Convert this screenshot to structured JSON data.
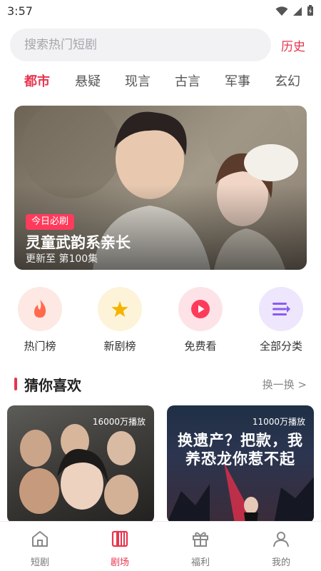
{
  "status_bar": {
    "time": "3:57"
  },
  "search": {
    "placeholder": "搜索热门短剧",
    "history_label": "历史"
  },
  "categories": [
    {
      "label": "都市",
      "active": true
    },
    {
      "label": "悬疑",
      "active": false
    },
    {
      "label": "现言",
      "active": false
    },
    {
      "label": "古言",
      "active": false
    },
    {
      "label": "军事",
      "active": false
    },
    {
      "label": "玄幻",
      "active": false
    }
  ],
  "banner": {
    "tag": "今日必刷",
    "title": "灵童武韵系亲长",
    "subtitle": "更新至 第100集"
  },
  "entries": [
    {
      "label": "热门榜",
      "icon": "fire-icon",
      "color": "#ff6a4d",
      "bg": "#fde8e3"
    },
    {
      "label": "新剧榜",
      "icon": "star-icon",
      "color": "#f6b400",
      "bg": "#fdf3d9"
    },
    {
      "label": "免费看",
      "icon": "play-icon",
      "color": "#ff3b5c",
      "bg": "#fde3e8"
    },
    {
      "label": "全部分类",
      "icon": "list-icon",
      "color": "#8a5cf0",
      "bg": "#eee6fd"
    }
  ],
  "section": {
    "title": "猜你喜欢",
    "more": "换一换 >"
  },
  "cards": [
    {
      "plays": "16000万播放",
      "poster_title": ""
    },
    {
      "plays": "11000万播放",
      "poster_title": "换遗产？把款，我养恐龙你惹不起"
    }
  ],
  "tabs": [
    {
      "label": "短剧",
      "icon": "home-icon",
      "active": false
    },
    {
      "label": "剧场",
      "icon": "theater-icon",
      "active": true
    },
    {
      "label": "福利",
      "icon": "gift-icon",
      "active": false
    },
    {
      "label": "我的",
      "icon": "user-icon",
      "active": false
    }
  ],
  "colors": {
    "accent": "#e8354f",
    "tag_bg": "#ff3b5c"
  }
}
